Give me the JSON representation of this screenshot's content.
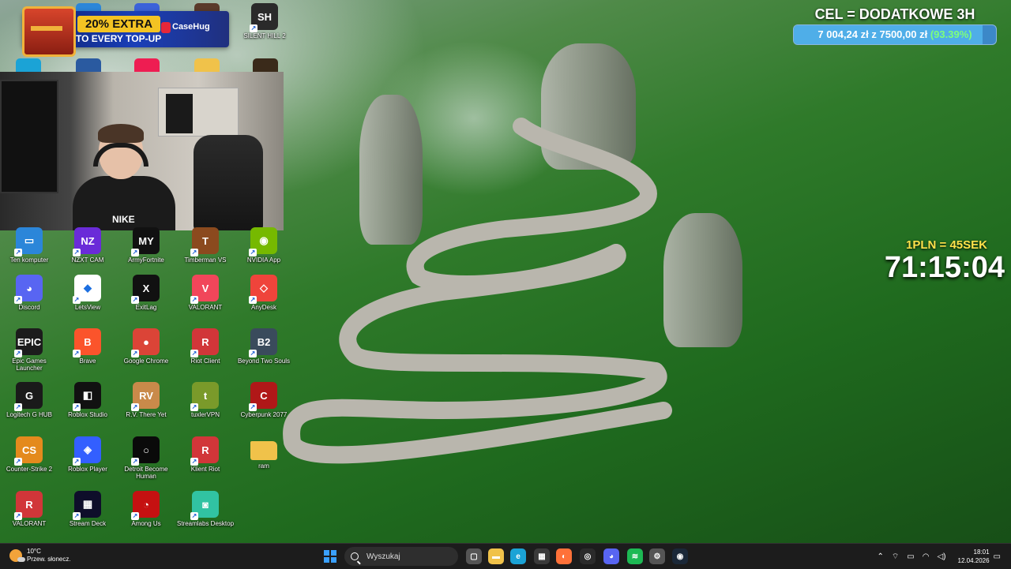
{
  "overlays": {
    "promo": {
      "headline": "20% EXTRA",
      "subline": "TO EVERY TOP-UP",
      "brand": "CaseHug"
    },
    "goal": {
      "title": "CEL = DODATKOWE 3H",
      "current": "7 004,24 zł",
      "connector": "z",
      "target": "7500,00 zł",
      "percent": "(93.39%)",
      "progress": 0.9339
    },
    "timer": {
      "rate": "1PLN = 45SEK",
      "value": "71:15:04"
    },
    "webcam": {
      "shirt_logo": "NIKE"
    }
  },
  "desktop_icons": [
    {
      "label": "SILENT HILL 2",
      "icon": "silent-hill-icon",
      "color": "#2a2a2a",
      "glyph": "SH"
    },
    {
      "label": "Ten komputer",
      "icon": "computer-icon",
      "color": "#2b86d9",
      "glyph": "▭"
    },
    {
      "label": "NZXT CAM",
      "icon": "nzxt-icon",
      "color": "#6a2bd8",
      "glyph": "NZ"
    },
    {
      "label": "ArmyFortnite",
      "icon": "fortnite-icon",
      "color": "#111111",
      "glyph": "MY"
    },
    {
      "label": "Timberman VS",
      "icon": "timberman-icon",
      "color": "#8b4a1e",
      "glyph": "T"
    },
    {
      "label": "NVIDIA App",
      "icon": "nvidia-icon",
      "color": "#76b900",
      "glyph": "◉"
    },
    {
      "label": "Discord",
      "icon": "discord-icon",
      "color": "#5865f2",
      "glyph": "◕"
    },
    {
      "label": "LetsView",
      "icon": "letsview-icon",
      "color": "#ffffff",
      "glyph": "◆"
    },
    {
      "label": "ExitLag",
      "icon": "exitlag-icon",
      "color": "#111111",
      "glyph": "X"
    },
    {
      "label": "VALORANT",
      "icon": "valorant-icon",
      "color": "#f1465a",
      "glyph": "V"
    },
    {
      "label": "AnyDesk",
      "icon": "anydesk-icon",
      "color": "#ef443b",
      "glyph": "◇"
    },
    {
      "label": "Epic Games Launcher",
      "icon": "epic-games-icon",
      "color": "#1c1c1c",
      "glyph": "EPIC"
    },
    {
      "label": "Brave",
      "icon": "brave-icon",
      "color": "#fb542b",
      "glyph": "B"
    },
    {
      "label": "Google Chrome",
      "icon": "chrome-icon",
      "color": "#db4437",
      "glyph": "●"
    },
    {
      "label": "Riot Client",
      "icon": "riot-client-icon",
      "color": "#d13639",
      "glyph": "R"
    },
    {
      "label": "Beyond Two Souls",
      "icon": "beyond-two-souls-icon",
      "color": "#3a4b5c",
      "glyph": "B2"
    },
    {
      "label": "Logitech G HUB",
      "icon": "logitech-icon",
      "color": "#1a1a1a",
      "glyph": "G"
    },
    {
      "label": "Roblox Studio",
      "icon": "roblox-studio-icon",
      "color": "#111111",
      "glyph": "◧"
    },
    {
      "label": "R.V. There Yet",
      "icon": "rv-there-yet-icon",
      "color": "#c98a4a",
      "glyph": "RV"
    },
    {
      "label": "tuxlerVPN",
      "icon": "tuxler-icon",
      "color": "#7a9a2a",
      "glyph": "t"
    },
    {
      "label": "Cyberpunk 2077",
      "icon": "cyberpunk-icon",
      "color": "#b01818",
      "glyph": "C"
    },
    {
      "label": "Counter-Strike 2",
      "icon": "counter-strike-icon",
      "color": "#e48a1d",
      "glyph": "CS"
    },
    {
      "label": "Roblox Player",
      "icon": "roblox-icon",
      "color": "#335fff",
      "glyph": "◈"
    },
    {
      "label": "Detroit Become Human",
      "icon": "detroit-icon",
      "color": "#0a0a0a",
      "glyph": "○"
    },
    {
      "label": "Klient Riot",
      "icon": "riot-klient-icon",
      "color": "#d13639",
      "glyph": "R"
    },
    {
      "label": "ram",
      "icon": "folder-icon",
      "color": "#f0c24a",
      "glyph": ""
    },
    {
      "label": "VALORANT",
      "icon": "valorant-2-icon",
      "color": "#d13639",
      "glyph": "R"
    },
    {
      "label": "Stream Deck",
      "icon": "stream-deck-icon",
      "color": "#0e0e2a",
      "glyph": "▦"
    },
    {
      "label": "Among Us",
      "icon": "among-us-icon",
      "color": "#c51111",
      "glyph": "◔"
    },
    {
      "label": "Streamlabs Desktop",
      "icon": "streamlabs-icon",
      "color": "#31c3a2",
      "glyph": "◙"
    }
  ],
  "partial_icons": [
    {
      "icon": "partial-app-icon-1",
      "color": "#2b86d9"
    },
    {
      "icon": "partial-app-icon-2",
      "color": "#3b62d9"
    },
    {
      "icon": "partial-app-icon-3",
      "color": "#5a3a2a"
    },
    {
      "icon": "partial-edge-icon",
      "color": "#1ba3d6"
    },
    {
      "icon": "partial-steam-icon",
      "color": "#2a5aa0"
    },
    {
      "icon": "partial-tiktok-icon",
      "color": "#ee1d52"
    },
    {
      "icon": "partial-folder-icon",
      "color": "#f0c24a"
    },
    {
      "icon": "partial-game-icon",
      "color": "#3a2a1a"
    }
  ],
  "taskbar": {
    "weather": {
      "temp": "10°C",
      "desc": "Przew. słonecz."
    },
    "search_placeholder": "Wyszukaj",
    "apps": [
      {
        "name": "task-view-icon",
        "color": "#555555",
        "glyph": "▢"
      },
      {
        "name": "file-explorer-icon",
        "color": "#f0c24a",
        "glyph": "▬"
      },
      {
        "name": "edge-icon",
        "color": "#1ba3d6",
        "glyph": "e"
      },
      {
        "name": "store-icon",
        "color": "#3a3a3a",
        "glyph": "▦"
      },
      {
        "name": "firefox-icon",
        "color": "#ff7139",
        "glyph": "◐"
      },
      {
        "name": "obs-icon",
        "color": "#2b2b2b",
        "glyph": "◎"
      },
      {
        "name": "discord-taskbar-icon",
        "color": "#5865f2",
        "glyph": "◕"
      },
      {
        "name": "spotify-icon",
        "color": "#1db954",
        "glyph": "≋"
      },
      {
        "name": "settings-icon",
        "color": "#555555",
        "glyph": "⚙"
      },
      {
        "name": "steam-icon",
        "color": "#1b2838",
        "glyph": "◉"
      }
    ],
    "time": "18:01",
    "date": "12.04.2026"
  }
}
